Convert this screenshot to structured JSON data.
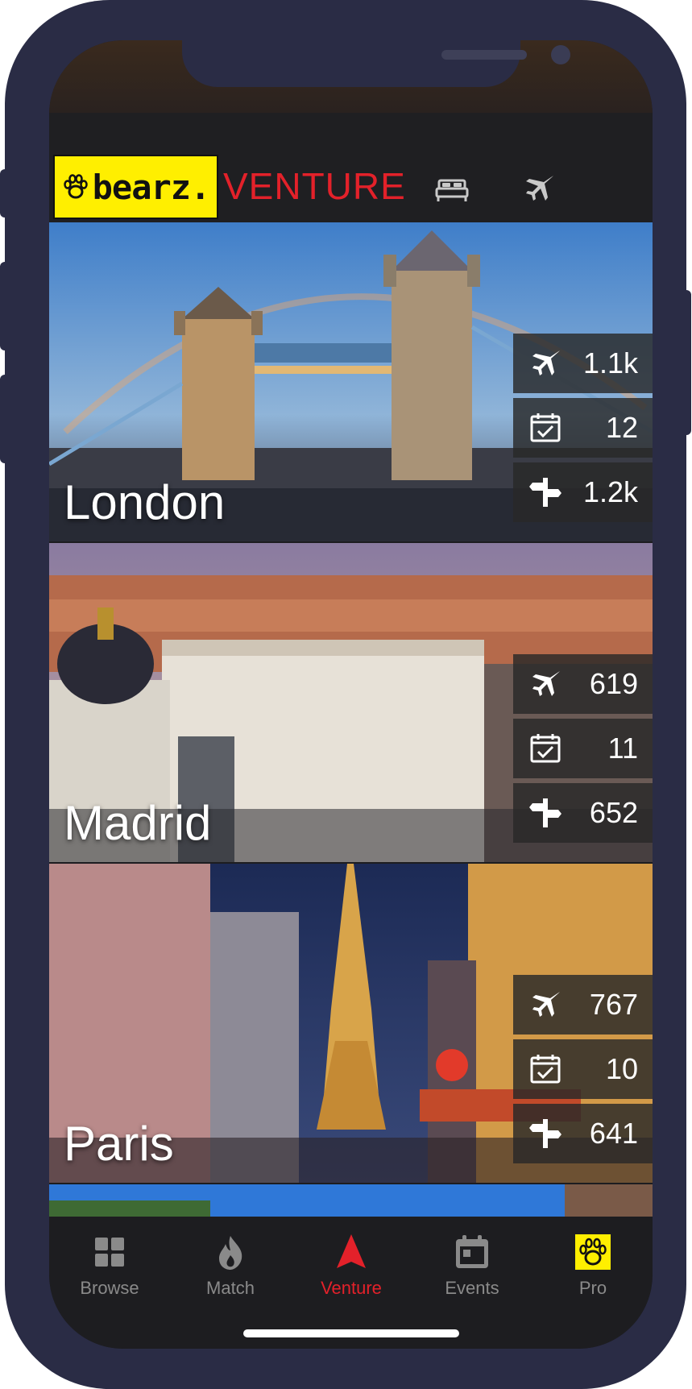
{
  "header": {
    "logo_text": "bearz.",
    "section_title": "VENTURE",
    "icons": [
      "bed-icon",
      "airplane-icon"
    ]
  },
  "cities": [
    {
      "name": "London",
      "flights": "1.1k",
      "events": "12",
      "places": "1.2k"
    },
    {
      "name": "Madrid",
      "flights": "619",
      "events": "11",
      "places": "652"
    },
    {
      "name": "Paris",
      "flights": "767",
      "events": "10",
      "places": "641"
    }
  ],
  "tabs": [
    {
      "label": "Browse",
      "icon": "grid-icon"
    },
    {
      "label": "Match",
      "icon": "flame-icon"
    },
    {
      "label": "Venture",
      "icon": "navigation-arrow-icon",
      "active": true
    },
    {
      "label": "Events",
      "icon": "calendar-icon"
    },
    {
      "label": "Pro",
      "icon": "paw-badge-icon"
    }
  ],
  "colors": {
    "accent": "#e3212a",
    "logo_bg": "#ffef00",
    "frame": "#2a2c45",
    "tab_bg": "#1d1d20",
    "inactive": "#8a8a8a"
  }
}
